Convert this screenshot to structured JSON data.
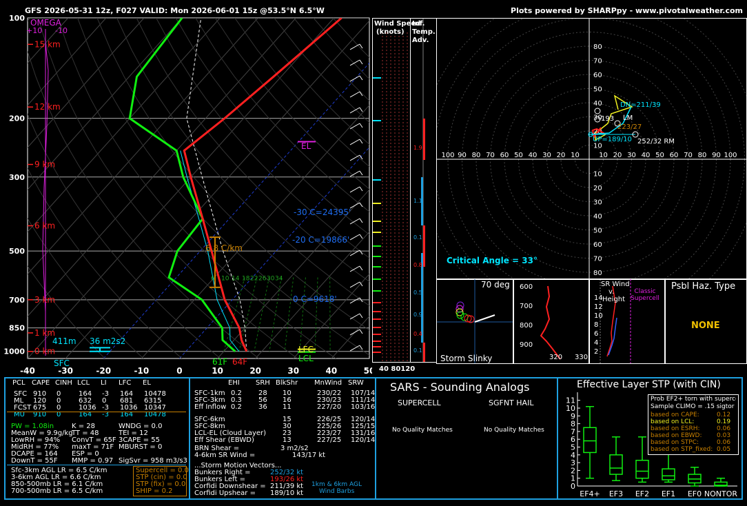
{
  "header": {
    "left": "GFS 2026-05-31 12z, F027  VALID: Mon 2026-06-01 15z @53.5°N 6.5°W",
    "right": "Plots powered by SHARPpy - www.pivotalweather.com"
  },
  "skewt": {
    "omega_label": "OMEGA",
    "omega_left": "+10",
    "omega_right": "-10",
    "xticks": [
      "-40",
      "-30",
      "-20",
      "-10",
      "0",
      "10",
      "20",
      "30",
      "40",
      "50"
    ],
    "pticks": [
      "100",
      "200",
      "300",
      "500",
      "700",
      "850",
      "1000"
    ],
    "heights": [
      "15 km",
      "12 km",
      "9 km",
      "6 km",
      "3 km",
      "1 km",
      "0 km"
    ],
    "lapse_label": "6.8 C/km",
    "el": "EL",
    "lfc": "LFC",
    "lcl": "LCL",
    "iso_m30": "-30 C=24395'",
    "iso_m20": "-20 C=19866'",
    "iso_0": "0 C=9618'",
    "hail_depth": "411m",
    "srh_label": "36 m2s2",
    "sfc": "SFC",
    "t_sfc": "61F",
    "td_sfc": "64F",
    "mix_ratios": [
      "6",
      "10",
      "14",
      "18",
      "22",
      "26",
      "30",
      "34"
    ]
  },
  "chart_data": {
    "type": "line",
    "title": "",
    "xlabel": "",
    "ylabel": "",
    "xlim": [
      -40,
      50
    ],
    "ylim": [
      1000,
      100
    ],
    "temperature": [
      [
        1000,
        16
      ],
      [
        925,
        12
      ],
      [
        850,
        8.5
      ],
      [
        700,
        -2
      ],
      [
        500,
        -17
      ],
      [
        400,
        -27
      ],
      [
        300,
        -40
      ],
      [
        250,
        -48
      ],
      [
        200,
        -45
      ],
      [
        150,
        -42
      ],
      [
        100,
        -38
      ]
    ],
    "dewpoint": [
      [
        1000,
        13
      ],
      [
        925,
        7
      ],
      [
        850,
        4
      ],
      [
        700,
        -8
      ],
      [
        600,
        -22
      ],
      [
        500,
        -26
      ],
      [
        400,
        -27
      ],
      [
        300,
        -42
      ],
      [
        250,
        -50
      ],
      [
        200,
        -70
      ],
      [
        150,
        -78
      ],
      [
        100,
        -80
      ]
    ],
    "wetbulb": [
      [
        1000,
        14
      ],
      [
        925,
        9
      ],
      [
        850,
        6
      ],
      [
        700,
        -4
      ],
      [
        500,
        -18
      ],
      [
        400,
        -28
      ],
      [
        300,
        -41
      ],
      [
        250,
        -49
      ]
    ]
  },
  "wind": {
    "label1": "Wind Speed",
    "label2": "(knots)",
    "inf1": "Inf.",
    "inf2": "Temp.",
    "inf3": "Adv.",
    "bottom": "40 80120",
    "adv_vals": [
      "1.9",
      "1.1",
      "0.1",
      "0.8",
      "0.5",
      "0.9",
      "0.4",
      "0.1"
    ]
  },
  "hodo": {
    "x_ticks": [
      "100",
      "90",
      "80",
      "70",
      "60",
      "50",
      "40",
      "30",
      "20",
      "10",
      "10",
      "20",
      "30",
      "40",
      "50",
      "60",
      "70",
      "80",
      "90",
      "100"
    ],
    "y_up": [
      "80",
      "70",
      "60",
      "50",
      "40",
      "30",
      "20",
      "10"
    ],
    "y_down": [
      "10",
      "20",
      "30",
      "40",
      "50",
      "60",
      "70",
      "80"
    ],
    "dn": "DN=211/39",
    "lm": "LM",
    "rm_l": "193",
    "lm_val": "223/27",
    "up": "UP=189/10",
    "rm": "252/32 RM",
    "crit": "Critical Angle = 33°"
  },
  "slinky": {
    "deg": "70 deg",
    "label": "Storm Slinky"
  },
  "theta": {
    "p": [
      "600",
      "700",
      "800",
      "900"
    ],
    "x": [
      "320",
      "330"
    ]
  },
  "srw": {
    "title1": "SR Wind",
    "title2": "v.",
    "title3": "Height",
    "classic": "Classic Supercell",
    "y": [
      "14",
      "12",
      "10",
      "8",
      "6",
      "4",
      "2"
    ]
  },
  "psbl": {
    "title": "Psbl Haz. Type",
    "value": "NONE"
  },
  "params": {
    "head": [
      "PCL",
      "CAPE",
      "CINH",
      "LCL",
      "LI",
      "LFC",
      "EL"
    ],
    "rows": [
      [
        "SFC",
        "910",
        "0",
        "164",
        "-3",
        "164",
        "10478"
      ],
      [
        "ML",
        "120",
        "0",
        "632",
        "0",
        "681",
        "6315"
      ],
      [
        "FCST",
        "675",
        "0",
        "1036",
        "-3",
        "1036",
        "10347"
      ],
      [
        "MU",
        "910",
        "0",
        "164",
        "-3",
        "164",
        "10478"
      ]
    ],
    "col1": [
      "PW = 1.08in",
      "MeanW = 9.9g/kg",
      "LowRH = 94%",
      "MidRH = 77%",
      "DCAPE = 164",
      "DownT = 55F"
    ],
    "col2": [
      "K = 28",
      "TT = 48",
      "ConvT = 65F",
      "maxT = 71F",
      "ESP = 0",
      "MMP = 0.97"
    ],
    "col3": [
      "WNDG = 0.0",
      "TEI = 12",
      "3CAPE = 55",
      "MBURST = 0",
      "",
      "SigSvr = 958 m3/s3"
    ],
    "lapse": [
      "Sfc-3km AGL LR = 6.5 C/km",
      "3-6km AGL LR = 6.6 C/km",
      "850-500mb LR = 6.1 C/km",
      "700-500mb LR = 6.5 C/km"
    ],
    "comp": [
      "Supercell = 0.0",
      "STP (cin) = 0.0",
      "STP (fix) = 0.0",
      "SHIP = 0.2"
    ]
  },
  "kin": {
    "head": [
      "EHI",
      "SRH",
      "BlkShr",
      "MnWind",
      "SRW"
    ],
    "rows": [
      [
        "SFC-1km",
        "0.2",
        "28",
        "10",
        "230/22",
        "107/14"
      ],
      [
        "SFC-3km",
        "0.3",
        "56",
        "16",
        "230/23",
        "111/14"
      ],
      [
        "Eff Inflow",
        "0.2",
        "36",
        "11",
        "227/20",
        "103/16"
      ],
      [
        "SFC-6km",
        "",
        "",
        "15",
        "226/25",
        "120/14"
      ],
      [
        "SFC-8km",
        "",
        "",
        "30",
        "225/26",
        "125/15"
      ],
      [
        "LCL-EL (Cloud Layer)",
        "",
        "",
        "23",
        "223/27",
        "131/16"
      ],
      [
        "Eff Shear (EBWD)",
        "",
        "",
        "13",
        "227/25",
        "120/14"
      ]
    ],
    "brn": "BRN Shear =",
    "brn_v": "3 m2/s2",
    "sr": "4-6km SR Wind =",
    "sr_v": "143/17 kt",
    "svh": "...Storm Motion Vectors...",
    "sv": [
      [
        "Bunkers Right =",
        "252/32 kt"
      ],
      [
        "Bunkers Left =",
        "193/26 kt"
      ],
      [
        "Corfidi Downshear =",
        "211/39 kt"
      ],
      [
        "Corfidi Upshear =",
        "189/10 kt"
      ]
    ],
    "barbs1": "1km & 6km AGL",
    "barbs2": "Wind Barbs"
  },
  "sars": {
    "title": "SARS - Sounding Analogs",
    "sup": "SUPERCELL",
    "hail": "SGFNT HAIL",
    "sup_v": "No Quality Matches",
    "hail_v": "No Quality Matches"
  },
  "stp": {
    "title": "Effective Layer STP (with CIN)",
    "yticks": [
      "11",
      "10",
      "9",
      "8",
      "7",
      "6",
      "5",
      "4",
      "3",
      "2",
      "1",
      "0"
    ],
    "cats": [
      "EF4+",
      "EF3",
      "EF2",
      "EF1",
      "EF0",
      "NONTOR"
    ],
    "box": [
      [
        0,
        1,
        4.3,
        5.8,
        7.5,
        10.2
      ],
      [
        0,
        0.7,
        1.5,
        2.3,
        4,
        6.3
      ],
      [
        0,
        0.5,
        1,
        1.9,
        3.3,
        6.3
      ],
      [
        0,
        0.5,
        0.8,
        1.3,
        2.2,
        4.7
      ],
      [
        0,
        0,
        0.4,
        0.9,
        1.5,
        2.4
      ],
      [
        0,
        0,
        0,
        0.1,
        0.5,
        1.0
      ]
    ],
    "prob_title": "Prob EF2+ torn with supercell",
    "clim": "Sample CLIMO = .15 sigtor",
    "probs": [
      [
        "based on CAPE:",
        "0.12"
      ],
      [
        "based on LCL:",
        "0.19"
      ],
      [
        "based on ESRH:",
        "0.06"
      ],
      [
        "based on EBWD:",
        "0.03"
      ],
      [
        "based on STPC:",
        "0.06"
      ],
      [
        "based on STP_fixed:",
        "0.05"
      ]
    ]
  },
  "colors": {
    "temp": "#ff2020",
    "dew": "#10ee10",
    "wb": "#00e5ff",
    "accent": "#1ea0e0",
    "magenta": "#e020e0",
    "yellow": "#f0f020",
    "orange": "#c88000"
  }
}
